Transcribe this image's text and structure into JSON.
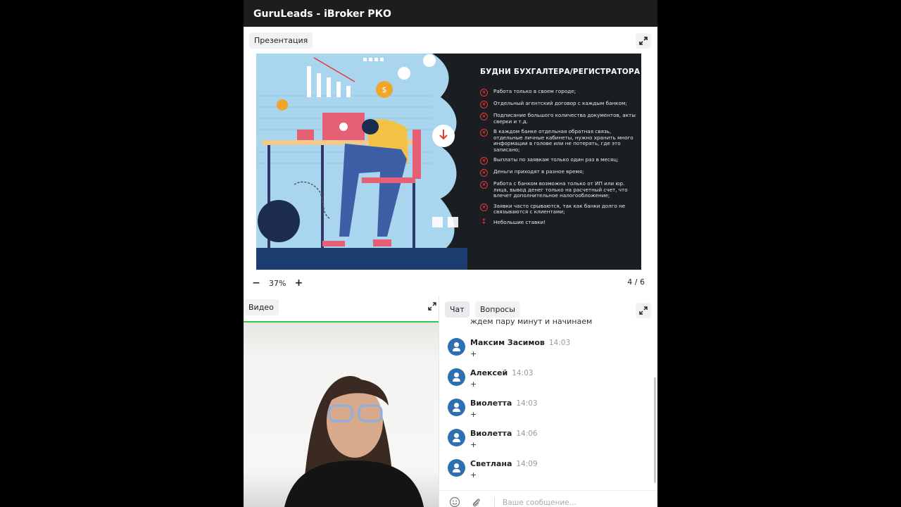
{
  "app": {
    "title": "GuruLeads - iBroker РКО"
  },
  "presentation": {
    "tab_label": "Презентация",
    "zoom_value": "37%",
    "zoom_out_label": "−",
    "zoom_in_label": "+",
    "page_current": "4",
    "page_separator": "/",
    "page_total": "6",
    "slide": {
      "title": "БУДНИ БУХГАЛТЕРА/РЕГИСТРАТОРА",
      "bullets": [
        "Работа только в своем городе;",
        "Отдельный агентский договор с каждым банком;",
        "Подписание большого количества документов, акты сверки и т.д.",
        "В каждом банке отдельная обратная связь, отдельные личные кабинеты, нужно хранить много информации в голове или не потерять, где это записано;",
        "Выплаты по заявкам только один раз в месяц;",
        "Деньги приходят в разное время;",
        "Работа с банком возможна только от ИП или юр. лица, вывод денег только на расчетный счет, что влечет дополнительное налогообложение;",
        "Заявки часто срываются, так как банки долго не связываются с клиентами;",
        "Небольшие ставки!"
      ],
      "coin_symbol": "$",
      "colors": {
        "dark_bg": "#1a1d22",
        "illustration_bg": "#a9d6ee",
        "accent_red": "#e53935"
      }
    }
  },
  "video": {
    "tab_label": "Видео"
  },
  "chat": {
    "tabs": [
      {
        "label": "Чат",
        "active": true
      },
      {
        "label": "Вопросы",
        "active": false
      }
    ],
    "partial_message_text": "ждем пару минут и начинаем",
    "messages": [
      {
        "name": "Максим Засимов",
        "time": "14:03",
        "text": "+"
      },
      {
        "name": "Алексей",
        "time": "14:03",
        "text": "+"
      },
      {
        "name": "Виолетта",
        "time": "14:03",
        "text": "+"
      },
      {
        "name": "Виолетта",
        "time": "14:06",
        "text": "+"
      },
      {
        "name": "Светлана",
        "time": "14:09",
        "text": "+"
      }
    ],
    "input_placeholder": "Ваше сообщение...",
    "colors": {
      "avatar": "#2d6fb0",
      "video_bar": "#37c24c"
    }
  }
}
